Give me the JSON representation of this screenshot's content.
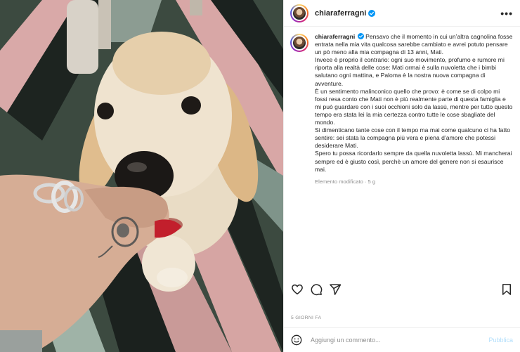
{
  "post": {
    "username": "chiaraferragni",
    "more_label": "•••",
    "caption_paragraphs": [
      "Pensavo che il momento in cui un’altra cagnolina fosse entrata nella mia vita qualcosa sarebbe cambiato e avrei potuto pensare un pò meno alla mia compagna di 13 anni, Mati.",
      "Invece è proprio il contrario: ogni suo movimento, profumo e rumore mi riporta alla realtà delle cose: Mati ormai è sulla nuvoletta che i bimbi salutano ogni mattina, e Paloma è la nostra nuova compagna di avventure.",
      "È un sentimento malinconico quello che provo: è come se di colpo mi fossi resa conto che Mati non è più realmente parte di questa famiglia e mi può guardare con i suoi occhioni solo da lassù, mentre per tutto questo tempo era stata lei la mia certezza contro tutte le cose sbagliate del mondo.",
      "Si dimenticano tante cose con il tempo ma mai come qualcuno ci ha fatto sentire: sei stata la compagna più vera e piena d’amore che potessi desiderare Mati.",
      "Spero tu possa ricordarlo sempre da quella nuvoletta lassù. Mi mancherai sempre ed è giusto così, perchè un amore del genere non si esaurisce mai."
    ],
    "edited_label": "Elemento modificato · 5 g",
    "time_ago": "5 GIORNI FA"
  },
  "icons": {
    "like": "heart-icon",
    "comment": "comment-icon",
    "share": "share-icon",
    "save": "bookmark-icon",
    "emoji": "emoji-icon",
    "verified": "verified-badge-icon"
  },
  "comment_box": {
    "placeholder": "Aggiungi un commento...",
    "publish_label": "Pubblica"
  },
  "colors": {
    "verified": "#0095f6",
    "publish_disabled": "#b2dffc",
    "text": "#262626",
    "muted": "#8e8e8e"
  }
}
